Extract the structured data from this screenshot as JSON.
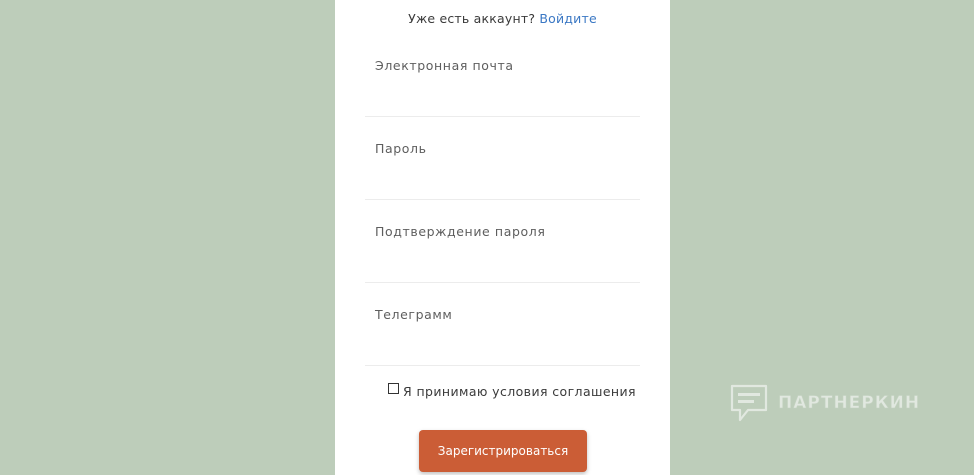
{
  "login_prompt": {
    "text": "Уже есть аккаунт?",
    "link": "Войдите"
  },
  "fields": [
    {
      "label": "Электронная почта",
      "value": ""
    },
    {
      "label": "Пароль",
      "value": ""
    },
    {
      "label": "Подтверждение пароля",
      "value": ""
    },
    {
      "label": "Телеграмм",
      "value": ""
    }
  ],
  "agreement": {
    "label": "Я принимаю условия соглашения",
    "checked": false
  },
  "submit": {
    "label": "Зарегистрироваться"
  },
  "watermark": {
    "text": "ПАРТНЕРКИН",
    "icon": "speech-bubble-icon"
  },
  "colors": {
    "background": "#bdcdba",
    "card": "#ffffff",
    "link": "#3b78c4",
    "button": "#cb5d36"
  }
}
